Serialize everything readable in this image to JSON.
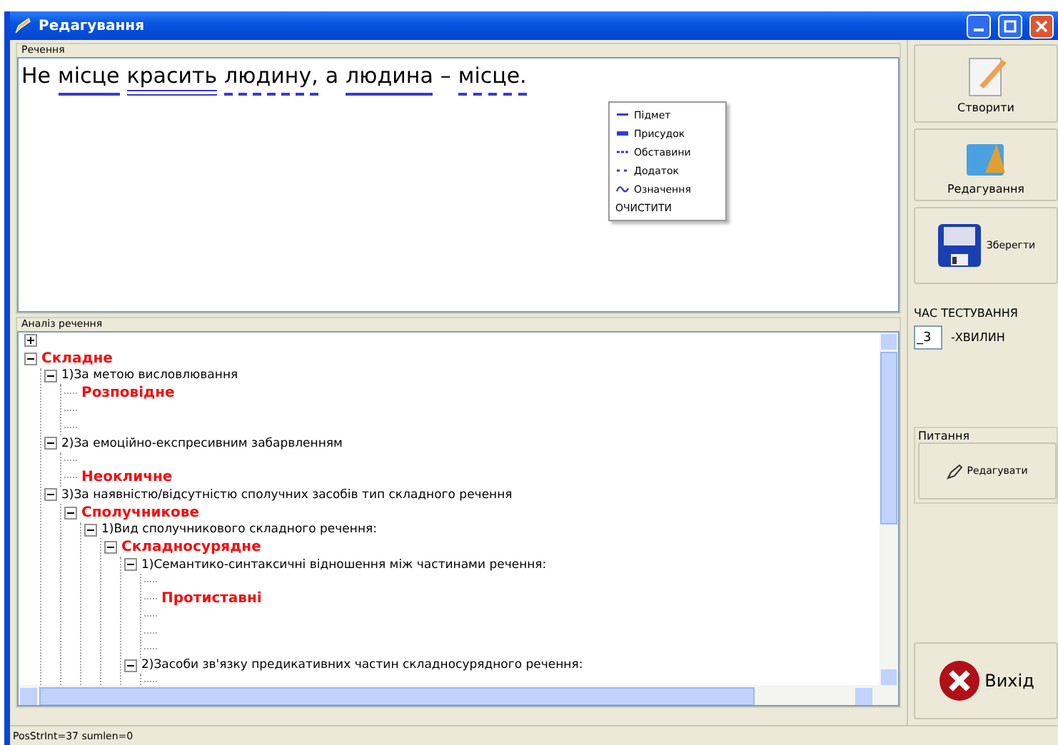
{
  "window": {
    "title": "Редагування"
  },
  "sentence_group": {
    "label": "Речення",
    "words": [
      {
        "text": "Не",
        "kind": "none"
      },
      {
        "text": "місце",
        "kind": "subject"
      },
      {
        "text": "красить",
        "kind": "predicate"
      },
      {
        "text": "людину,",
        "kind": "object"
      },
      {
        "text": "а",
        "kind": "none"
      },
      {
        "text": "людина",
        "kind": "subject"
      },
      {
        "text": "–",
        "kind": "none"
      },
      {
        "text": "місце.",
        "kind": "object"
      }
    ]
  },
  "legend_menu": [
    {
      "label": "Підмет",
      "kind": "subject"
    },
    {
      "label": "Присудок",
      "kind": "predicate"
    },
    {
      "label": "Обставини",
      "kind": "adverbial"
    },
    {
      "label": "Додаток",
      "kind": "object"
    },
    {
      "label": "Означення",
      "kind": "attribute"
    },
    {
      "label": "ОЧИСТИТИ",
      "kind": "clear"
    }
  ],
  "analysis": {
    "label": "Аналіз речення",
    "tree": [
      {
        "kind": "empty",
        "expanded": false
      },
      {
        "kind": "value",
        "label": "Складне",
        "expanded": true,
        "children": [
          {
            "kind": "text",
            "label": "1)За метою висловлювання",
            "expanded": true,
            "children": [
              {
                "kind": "value",
                "label": "Розповідне"
              },
              {
                "kind": "empty"
              },
              {
                "kind": "empty"
              }
            ]
          },
          {
            "kind": "text",
            "label": "2)За емоційно-експресивним забарвленням",
            "expanded": true,
            "children": [
              {
                "kind": "empty"
              },
              {
                "kind": "value",
                "label": "Неокличне"
              }
            ]
          },
          {
            "kind": "text",
            "label": "3)За наявністю/відсутністю сполучних засобів тип складного речення",
            "expanded": true,
            "children": [
              {
                "kind": "value",
                "label": "Сполучникове",
                "expanded": true,
                "children": [
                  {
                    "kind": "text",
                    "label": "1)Вид сполучникового складного речення:",
                    "expanded": true,
                    "children": [
                      {
                        "kind": "value",
                        "label": "Складносурядне",
                        "expanded": true,
                        "children": [
                          {
                            "kind": "text",
                            "label": "1)Семантико-синтаксичні відношення між частинами речення:",
                            "expanded": true,
                            "children": [
                              {
                                "kind": "empty"
                              },
                              {
                                "kind": "value",
                                "label": "Протиставні"
                              },
                              {
                                "kind": "empty"
                              },
                              {
                                "kind": "empty"
                              },
                              {
                                "kind": "empty"
                              }
                            ]
                          },
                          {
                            "kind": "text",
                            "label": "2)Засоби зв'язку предикативних частин складносурядного речення:",
                            "expanded": true,
                            "children": [
                              {
                                "kind": "empty"
                              }
                            ]
                          }
                        ]
                      }
                    ]
                  }
                ]
              }
            ]
          }
        ]
      }
    ]
  },
  "sidebar": {
    "create": "Створити",
    "edit": "Редагування",
    "save": "Зберегти",
    "test_time_label": "ЧАС ТЕСТУВАННЯ",
    "minutes_value": "_3",
    "minutes_label": "-ХВИЛИН",
    "questions_group": "Питання",
    "edit_questions": "Редагувати",
    "exit": "Вихід"
  },
  "status_bar": "PosStrInt=37 sumlen=0"
}
